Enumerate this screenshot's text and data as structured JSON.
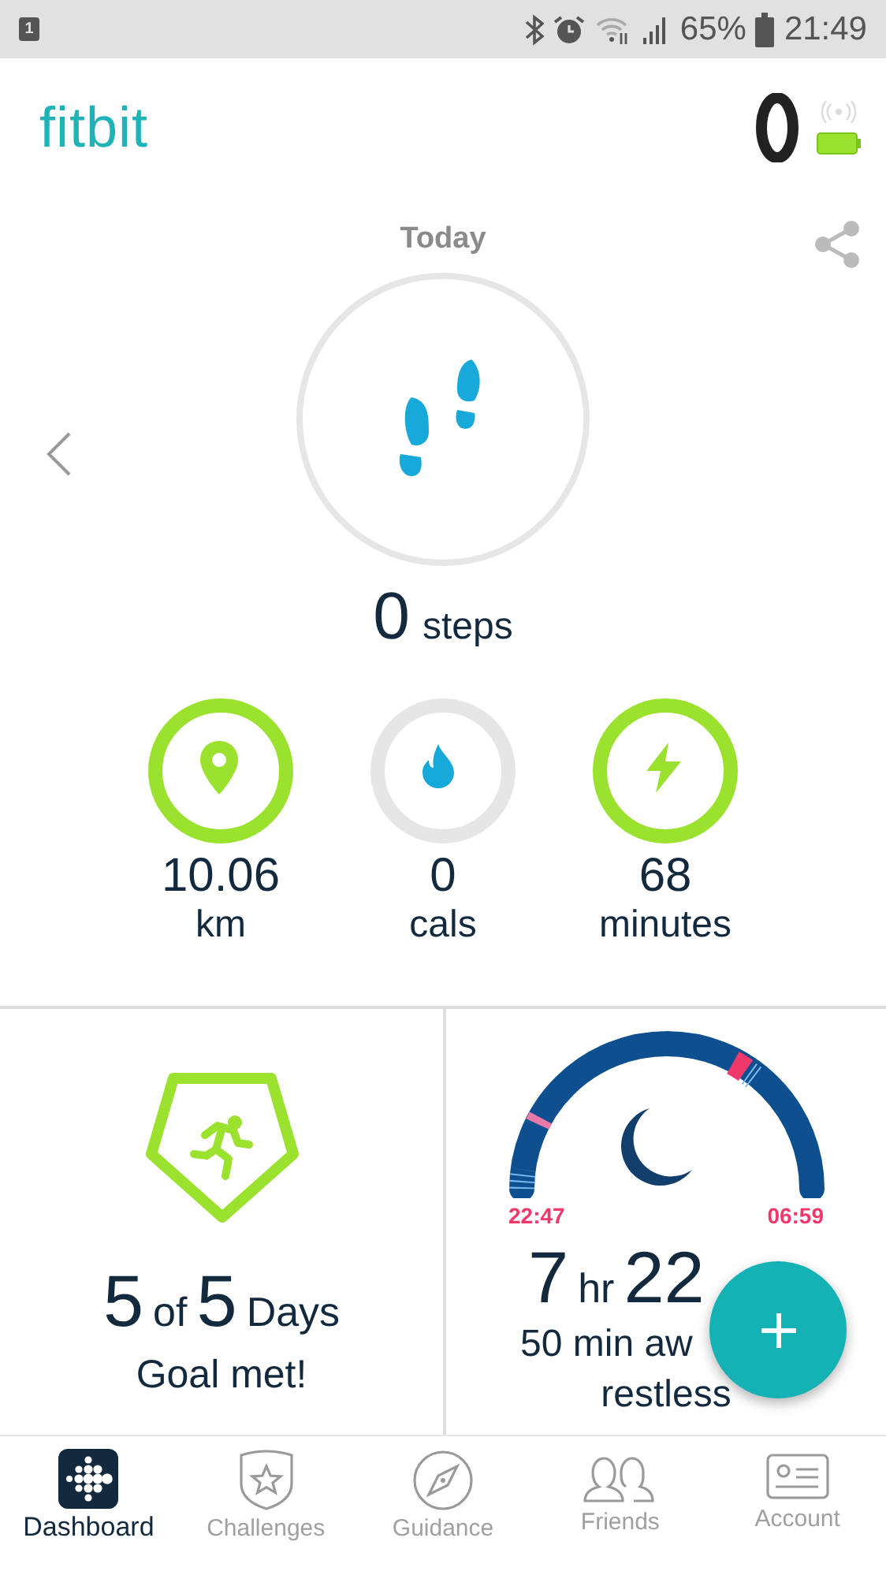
{
  "status_bar": {
    "notification": "1",
    "battery": "65%",
    "time": "21:49"
  },
  "header": {
    "logo": "fitbit"
  },
  "today": {
    "title": "Today",
    "steps": {
      "value": "0",
      "unit": "steps"
    }
  },
  "rings": [
    {
      "kind": "distance",
      "value": "10.06",
      "unit": "km",
      "goal_met": true
    },
    {
      "kind": "calories",
      "value": "0",
      "unit": "cals",
      "goal_met": false
    },
    {
      "kind": "active",
      "value": "68",
      "unit": "minutes",
      "goal_met": true
    }
  ],
  "tiles": {
    "goal": {
      "done": "5",
      "word": "of",
      "total": "5",
      "unit": "Days",
      "caption": "Goal met!"
    },
    "sleep": {
      "start": "22:47",
      "end": "06:59",
      "hours": "7",
      "hours_unit": "hr",
      "minutes": "22",
      "awake": "50 min aw",
      "restless": "restless"
    }
  },
  "nav": [
    {
      "kind": "dashboard",
      "label": "Dashboard",
      "selected": true
    },
    {
      "kind": "challenges",
      "label": "Challenges",
      "selected": false
    },
    {
      "kind": "guidance",
      "label": "Guidance",
      "selected": false
    },
    {
      "kind": "friends",
      "label": "Friends",
      "selected": false
    },
    {
      "kind": "account",
      "label": "Account",
      "selected": false
    }
  ]
}
